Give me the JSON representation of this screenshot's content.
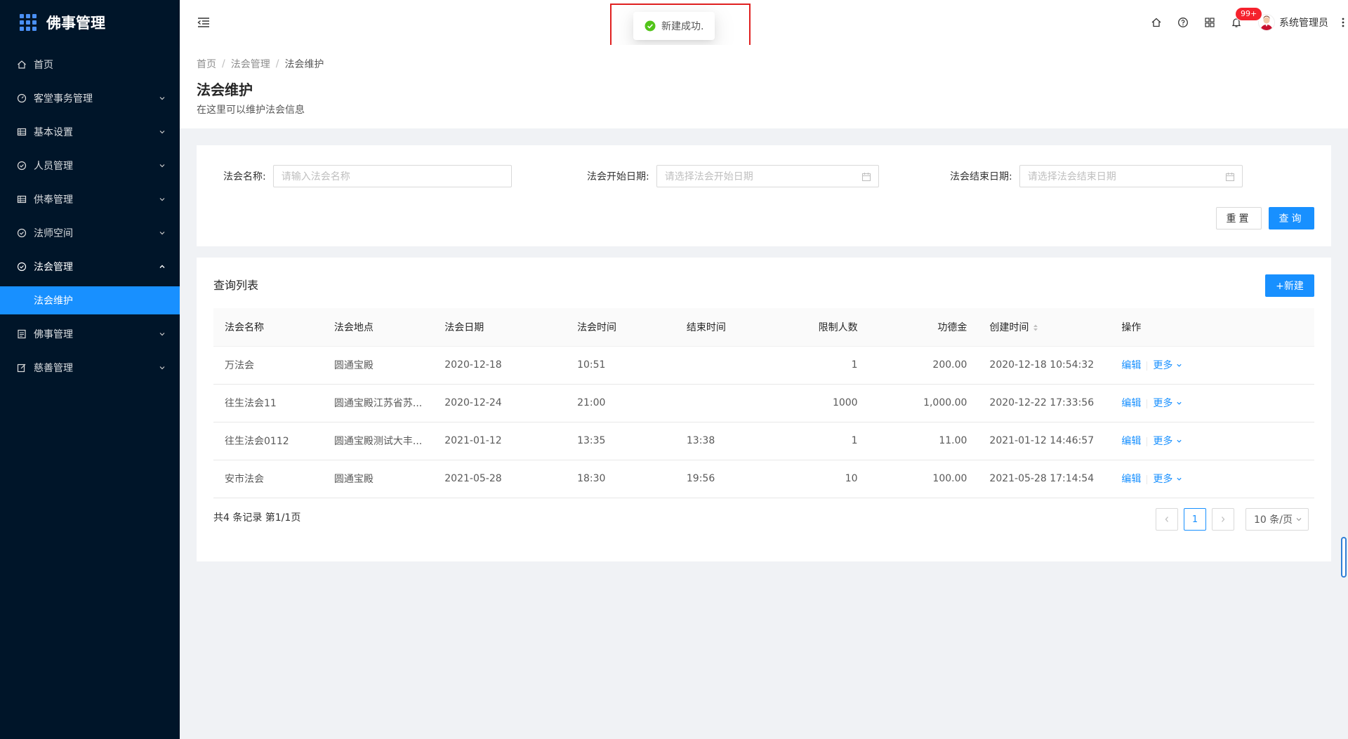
{
  "app": {
    "title": "佛事管理"
  },
  "sidebar": {
    "items": [
      {
        "label": "首页",
        "icon": "home-icon"
      },
      {
        "label": "客堂事务管理",
        "icon": "dashboard-icon"
      },
      {
        "label": "基本设置",
        "icon": "table-icon"
      },
      {
        "label": "人员管理",
        "icon": "check-circle-icon"
      },
      {
        "label": "供奉管理",
        "icon": "table-icon"
      },
      {
        "label": "法师空间",
        "icon": "check-circle-icon"
      },
      {
        "label": "法会管理",
        "icon": "check-circle-icon"
      },
      {
        "label": "佛事管理",
        "icon": "profile-icon"
      },
      {
        "label": "慈善管理",
        "icon": "form-icon"
      }
    ],
    "active_sub": "法会维护"
  },
  "header": {
    "notification_count": "99+",
    "user_name": "系统管理员"
  },
  "toast": {
    "message": "新建成功."
  },
  "breadcrumb": {
    "home": "首页",
    "parent": "法会管理",
    "current": "法会维护"
  },
  "page": {
    "title": "法会维护",
    "description": "在这里可以维护法会信息"
  },
  "search": {
    "name_label": "法会名称:",
    "name_placeholder": "请输入法会名称",
    "start_label": "法会开始日期:",
    "start_placeholder": "请选择法会开始日期",
    "end_label": "法会结束日期:",
    "end_placeholder": "请选择法会结束日期",
    "reset_label": "重置",
    "query_label": "查询"
  },
  "table": {
    "title": "查询列表",
    "new_label": "+新建",
    "columns": [
      "法会名称",
      "法会地点",
      "法会日期",
      "法会时间",
      "结束时间",
      "限制人数",
      "功德金",
      "创建时间",
      "操作"
    ],
    "rows": [
      [
        "万法会",
        "圆通宝殿",
        "2020-12-18",
        "10:51",
        "",
        "1",
        "200.00",
        "2020-12-18 10:54:32"
      ],
      [
        "往生法会11",
        "圆通宝殿江苏省苏...",
        "2020-12-24",
        "21:00",
        "",
        "1000",
        "1,000.00",
        "2020-12-22 17:33:56"
      ],
      [
        "往生法会0112",
        "圆通宝殿测试大丰...",
        "2021-01-12",
        "13:35",
        "13:38",
        "1",
        "11.00",
        "2021-01-12 14:46:57"
      ],
      [
        "安市法会",
        "圆通宝殿",
        "2021-05-28",
        "18:30",
        "19:56",
        "10",
        "100.00",
        "2021-05-28 17:14:54"
      ]
    ],
    "edit_label": "编辑",
    "more_label": "更多",
    "total_text": "共4 条记录 第1/1页",
    "current_page": "1",
    "page_size": "10 条/页"
  }
}
